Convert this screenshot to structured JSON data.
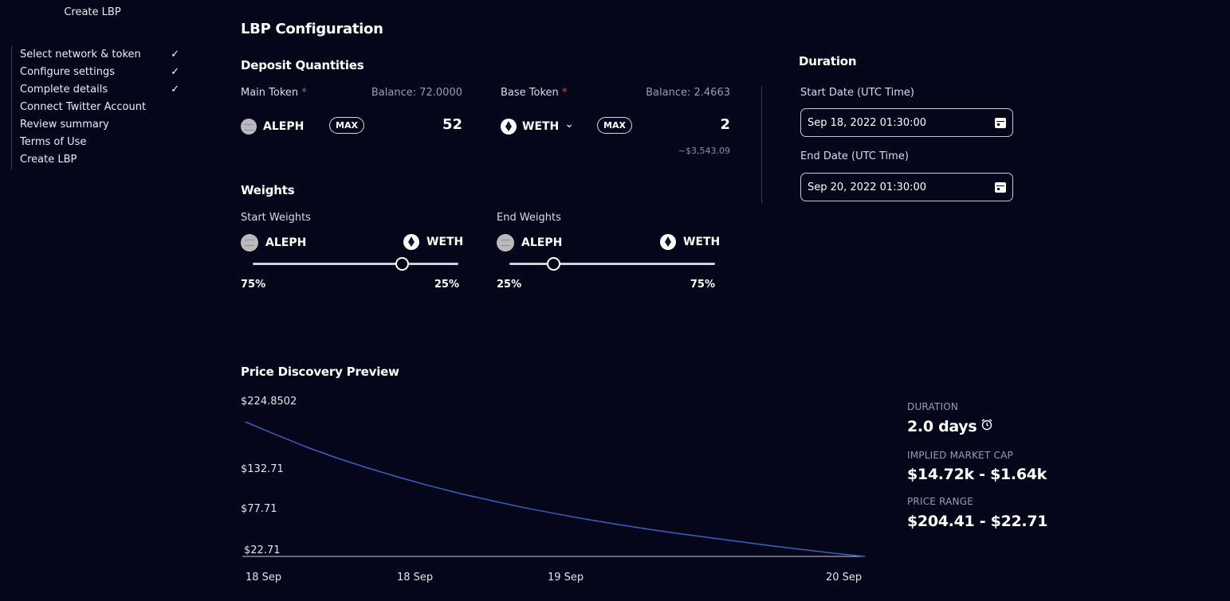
{
  "sidebar": {
    "title": "Create LBP",
    "steps": [
      {
        "label": "Select network & token",
        "done": true
      },
      {
        "label": "Configure settings",
        "done": true
      },
      {
        "label": "Complete details",
        "done": true
      },
      {
        "label": "Connect Twitter Account",
        "done": false
      },
      {
        "label": "Review summary",
        "done": false
      },
      {
        "label": "Terms of Use",
        "done": false
      },
      {
        "label": "Create LBP",
        "done": false
      }
    ],
    "check_glyph": "✓"
  },
  "page": {
    "title": "LBP Configuration"
  },
  "deposit": {
    "title": "Deposit Quantities",
    "main": {
      "label": "Main Token",
      "required": "*",
      "balance": "Balance: 72.0000",
      "token": "ALEPH",
      "max": "MAX",
      "amount": "52"
    },
    "base": {
      "label": "Base Token",
      "required": "*",
      "balance": "Balance: 2.4663",
      "token": "WETH",
      "chevron": "⌄",
      "max": "MAX",
      "amount": "2",
      "usd": "~$3,543.09"
    }
  },
  "weights": {
    "title": "Weights",
    "start": {
      "label": "Start Weights",
      "left_token": "ALEPH",
      "right_token": "WETH",
      "left_pct": "75%",
      "right_pct": "25%",
      "value": 0.75
    },
    "end": {
      "label": "End Weights",
      "left_token": "ALEPH",
      "right_token": "WETH",
      "left_pct": "25%",
      "right_pct": "75%",
      "value": 0.25
    }
  },
  "duration": {
    "title": "Duration",
    "start_label": "Start Date (UTC Time)",
    "start_value": "Sep 18, 2022 01:30:00",
    "end_label": "End Date (UTC Time)",
    "end_value": "Sep 20, 2022 01:30:00"
  },
  "preview": {
    "title": "Price Discovery Preview",
    "stats": [
      {
        "label": "DURATION",
        "value": "2.0 days",
        "icon": "alarm-clock-icon"
      },
      {
        "label": "IMPLIED MARKET CAP",
        "value": "$14.72k - $1.64k"
      },
      {
        "label": "PRICE RANGE",
        "value": "$204.41 - $22.71"
      }
    ]
  },
  "chart_data": {
    "type": "line",
    "title": "",
    "y_ticks": [
      "$224.8502",
      "$132.71",
      "$77.71",
      "$22.71"
    ],
    "x_ticks": [
      "18 Sep",
      "18 Sep",
      "19 Sep",
      "20 Sep"
    ],
    "ylim": [
      22.71,
      224.8502
    ],
    "xlim_days": [
      0,
      2
    ],
    "series": [
      {
        "color": "#3b5fc4",
        "x": [
          0,
          0.1,
          0.2,
          0.3,
          0.4,
          0.5,
          0.6,
          0.7,
          0.8,
          0.9,
          1.0,
          1.1,
          1.2,
          1.3,
          1.4,
          1.5,
          1.6,
          1.7,
          1.8,
          1.9,
          2.0
        ],
        "y": [
          204.41,
          186.9,
          170.0,
          155.0,
          141.5,
          129.0,
          117.5,
          107.0,
          97.5,
          88.5,
          80.5,
          73.0,
          66.0,
          59.5,
          53.5,
          48.0,
          42.5,
          37.0,
          32.0,
          27.0,
          22.71
        ]
      }
    ],
    "grid": false,
    "legend": "none"
  },
  "colors": {
    "background": "#05061a",
    "accent_line": "#3b5fc4",
    "required": "#e0444f"
  }
}
